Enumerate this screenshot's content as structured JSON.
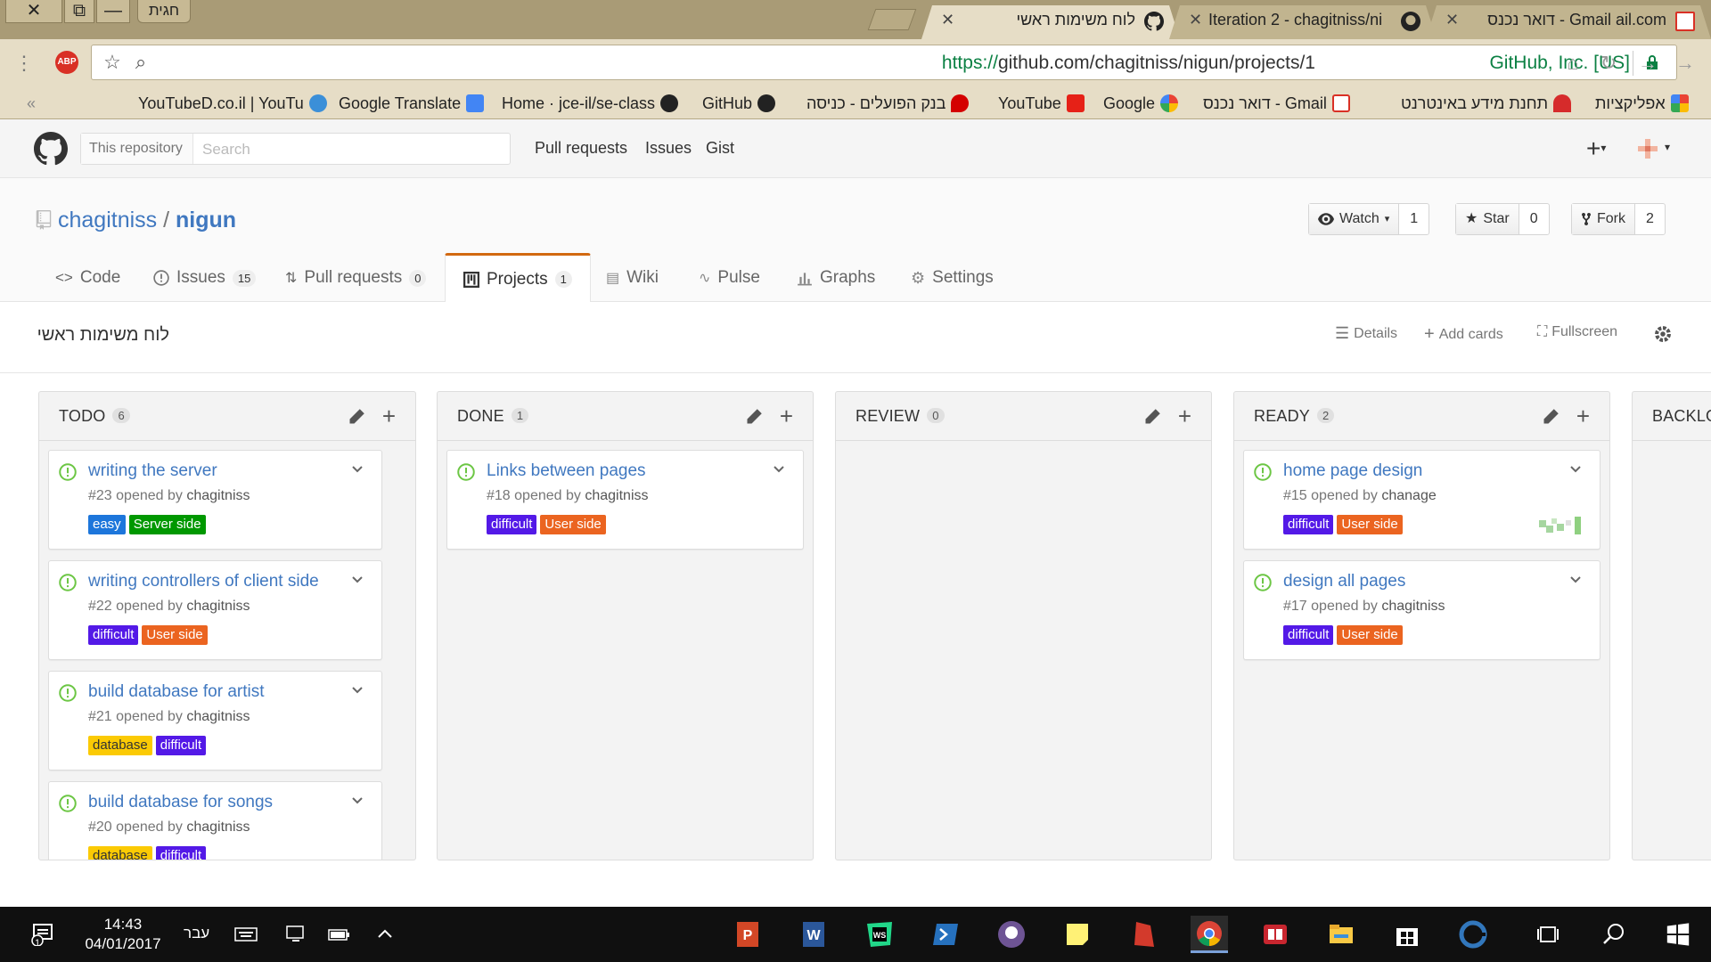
{
  "browser": {
    "profile": "חגית",
    "tabs": [
      {
        "title": "לוח משימות ראשי",
        "active": true
      },
      {
        "title": "Iteration 2 - chagitniss/ni",
        "active": false
      },
      {
        "title": "דואר נכנס - Gmail ail.com",
        "active": false
      }
    ],
    "url_scheme": "https://",
    "url_rest": "github.com/chagitniss/nigun/projects/1",
    "ev_cert": "GitHub, Inc. [US]",
    "bookmarks": [
      "YouTubeD.co.il | YouTu",
      "Google Translate",
      "Home · jce-il/se-class",
      "GitHub",
      "בנק הפועלים - כניסה",
      "YouTube",
      "Google",
      "דואר נכנס - Gmail",
      "תחנת מידע באינטרנט",
      "אפליקציות"
    ]
  },
  "github": {
    "scope_label": "This repository",
    "search_placeholder": "Search",
    "nav": [
      "Pull requests",
      "Issues",
      "Gist"
    ]
  },
  "repo": {
    "owner": "chagitniss",
    "separator": " / ",
    "name": "nigun",
    "watch_label": "Watch",
    "watch_count": "1",
    "star_label": "Star",
    "star_count": "0",
    "fork_label": "Fork",
    "fork_count": "2",
    "tabs": {
      "code": "Code",
      "issues": "Issues",
      "issues_count": "15",
      "pulls": "Pull requests",
      "pulls_count": "0",
      "projects": "Projects",
      "projects_count": "1",
      "wiki": "Wiki",
      "pulse": "Pulse",
      "graphs": "Graphs",
      "settings": "Settings"
    }
  },
  "project": {
    "name": "לוח משימות ראשי",
    "details_label": "Details",
    "add_cards_label": "Add cards",
    "fullscreen_label": "Fullscreen"
  },
  "columns": [
    {
      "name": "TODO",
      "count": "6",
      "cards": [
        {
          "title": "writing the server",
          "number": "#23",
          "opened_by": "opened by",
          "user": "chagitniss",
          "labels": [
            {
              "text": "easy",
              "color": "#1d76db"
            },
            {
              "text": "Server side",
              "color": "#009800"
            }
          ]
        },
        {
          "title": "writing controllers of client side",
          "number": "#22",
          "opened_by": "opened by",
          "user": "chagitniss",
          "labels": [
            {
              "text": "difficult",
              "color": "#5319e7"
            },
            {
              "text": "User side",
              "color": "#eb6420"
            }
          ]
        },
        {
          "title": "build database for artist",
          "number": "#21",
          "opened_by": "opened by",
          "user": "chagitniss",
          "labels": [
            {
              "text": "database",
              "color": "#fbca04"
            },
            {
              "text": "difficult",
              "color": "#5319e7"
            }
          ]
        },
        {
          "title": "build database for songs",
          "number": "#20",
          "opened_by": "opened by",
          "user": "chagitniss",
          "labels": [
            {
              "text": "database",
              "color": "#fbca04"
            },
            {
              "text": "difficult",
              "color": "#5319e7"
            }
          ]
        }
      ]
    },
    {
      "name": "DONE",
      "count": "1",
      "cards": [
        {
          "title": "Links between pages",
          "number": "#18",
          "opened_by": "opened by",
          "user": "chagitniss",
          "labels": [
            {
              "text": "difficult",
              "color": "#5319e7"
            },
            {
              "text": "User side",
              "color": "#eb6420"
            }
          ]
        }
      ]
    },
    {
      "name": "REVIEW",
      "count": "0",
      "cards": []
    },
    {
      "name": "READY",
      "count": "2",
      "cards": [
        {
          "title": "home page design",
          "number": "#15",
          "opened_by": "opened by",
          "user": "chanage",
          "assignee_avatar": true,
          "labels": [
            {
              "text": "difficult",
              "color": "#5319e7"
            },
            {
              "text": "User side",
              "color": "#eb6420"
            }
          ]
        },
        {
          "title": "design all pages",
          "number": "#17",
          "opened_by": "opened by",
          "user": "chagitniss",
          "labels": [
            {
              "text": "difficult",
              "color": "#5319e7"
            },
            {
              "text": "User side",
              "color": "#eb6420"
            }
          ]
        }
      ]
    },
    {
      "name": "BACKLO",
      "count": "",
      "cards": []
    }
  ],
  "taskbar": {
    "time": "14:43",
    "date": "04/01/2017",
    "language": "עבר",
    "notification_count": "1"
  }
}
